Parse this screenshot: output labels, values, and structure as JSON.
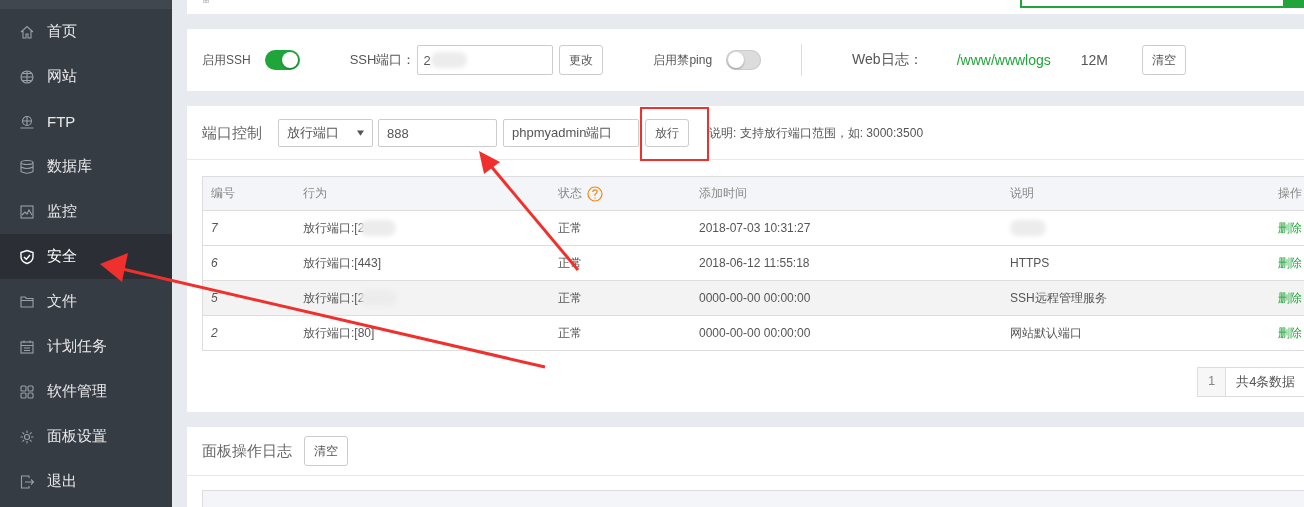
{
  "sidebar": {
    "items": [
      {
        "label": "首页",
        "selected": false
      },
      {
        "label": "网站",
        "selected": false
      },
      {
        "label": "FTP",
        "selected": false
      },
      {
        "label": "数据库",
        "selected": false
      },
      {
        "label": "监控",
        "selected": false
      },
      {
        "label": "安全",
        "selected": true
      },
      {
        "label": "文件",
        "selected": false
      },
      {
        "label": "计划任务",
        "selected": false
      },
      {
        "label": "软件管理",
        "selected": false
      },
      {
        "label": "面板设置",
        "selected": false
      },
      {
        "label": "退出",
        "selected": false
      }
    ]
  },
  "ssh_panel": {
    "ssh_label": "启用SSH",
    "ssh_enabled": true,
    "port_label": "SSH端口：",
    "port_value": "2",
    "change_button": "更改",
    "ping_label": "启用禁ping",
    "ping_blocked": false,
    "web_log_label": "Web日志：",
    "web_log_path": "/www/wwwlogs",
    "web_log_size": "12M",
    "clear_button": "清空"
  },
  "port_control": {
    "title": "端口控制",
    "select_value": "放行端口",
    "port_value": "888",
    "remark_value": "phpmyadmin端口",
    "submit_button": "放行",
    "hint": "说明: 支持放行端口范围，如: 3000:3500",
    "table": {
      "columns": [
        "编号",
        "行为",
        "状态",
        "添加时间",
        "说明",
        "操作"
      ],
      "rows": [
        {
          "id": "7",
          "action": "放行端口:[2",
          "status": "正常",
          "time": "2018-07-03 10:31:27",
          "note": "",
          "delete": "删除",
          "highlighted": false
        },
        {
          "id": "6",
          "action": "放行端口:[443]",
          "status": "正常",
          "time": "2018-06-12 11:55:18",
          "note": "HTTPS",
          "delete": "删除",
          "highlighted": false
        },
        {
          "id": "5",
          "action": "放行端口:[2",
          "status": "正常",
          "time": "0000-00-00 00:00:00",
          "note": "SSH远程管理服务",
          "delete": "删除",
          "highlighted": true
        },
        {
          "id": "2",
          "action": "放行端口:[80]",
          "status": "正常",
          "time": "0000-00-00 00:00:00",
          "note": "网站默认端口",
          "delete": "删除",
          "highlighted": false
        }
      ]
    },
    "pagination": {
      "page": "1",
      "total": "共4条数据"
    }
  },
  "log_panel": {
    "title": "面板操作日志",
    "clear_button": "清空"
  }
}
